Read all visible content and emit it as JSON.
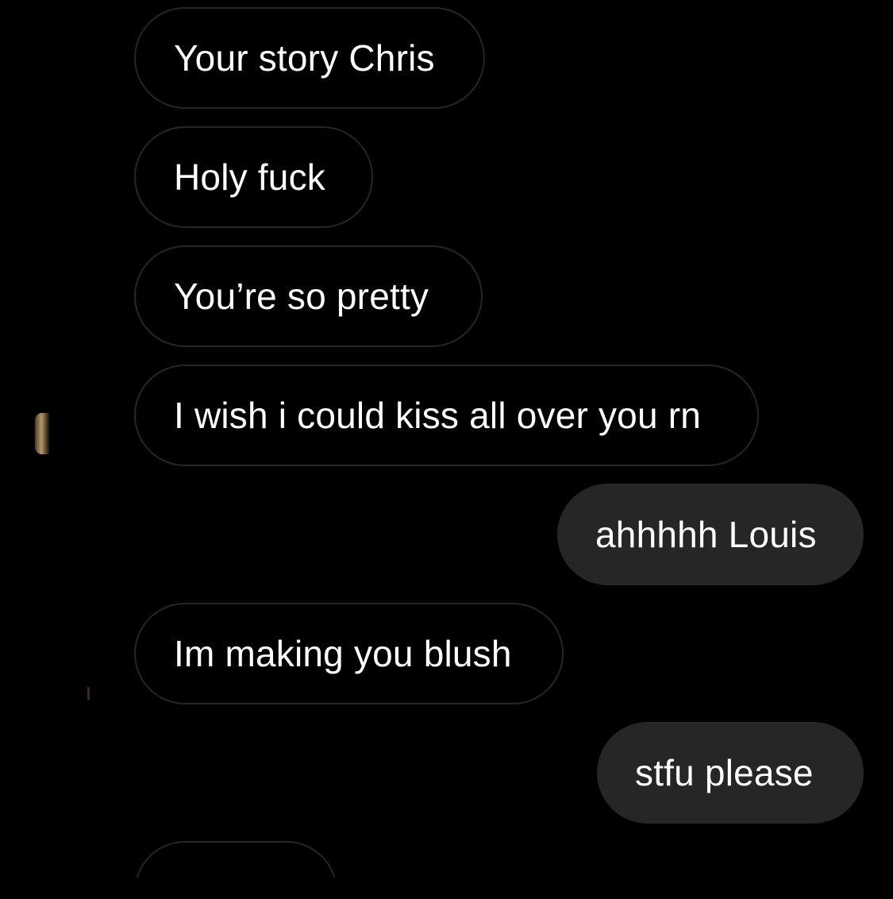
{
  "messages": [
    {
      "text": "Your story Chris",
      "direction": "incoming"
    },
    {
      "text": "Holy fuck",
      "direction": "incoming"
    },
    {
      "text": "You’re so pretty",
      "direction": "incoming"
    },
    {
      "text": "I wish i could kiss all over you rn",
      "direction": "incoming"
    },
    {
      "text": "ahhhhh Louis",
      "direction": "outgoing"
    },
    {
      "text": "Im making you blush",
      "direction": "incoming"
    },
    {
      "text": "stfu please",
      "direction": "outgoing"
    }
  ],
  "colors": {
    "background": "#000000",
    "incoming_border": "#262626",
    "outgoing_fill": "#262626",
    "text": "#ffffff"
  }
}
